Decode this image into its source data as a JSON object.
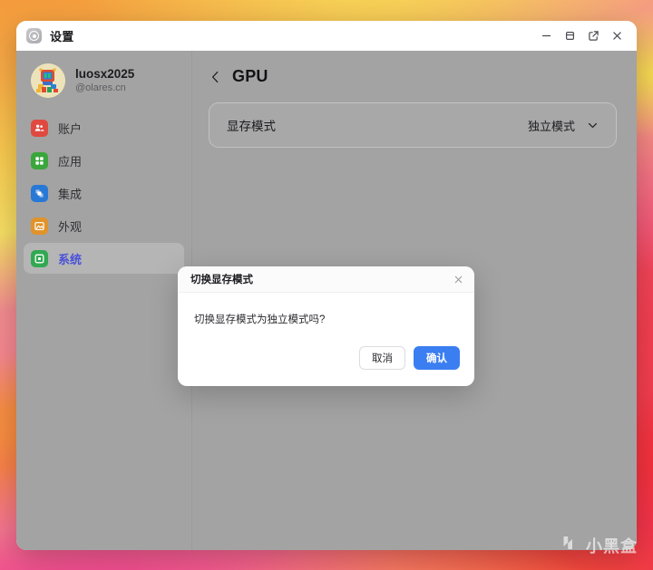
{
  "window": {
    "title": "设置",
    "app_icon": "settings-target-icon",
    "controls": [
      {
        "name": "minimize",
        "glyph": "minimize-icon"
      },
      {
        "name": "maximize",
        "glyph": "maximize-icon"
      },
      {
        "name": "open-external",
        "glyph": "external-link-icon"
      },
      {
        "name": "close",
        "glyph": "close-icon"
      }
    ]
  },
  "sidebar": {
    "profile": {
      "name": "luosx2025",
      "handle": "@olares.cn",
      "avatar": "user-avatar"
    },
    "items": [
      {
        "label": "账户",
        "icon": "account-icon",
        "color": "#e0493f",
        "active": false
      },
      {
        "label": "应用",
        "icon": "apps-icon",
        "color": "#3aa63c",
        "active": false
      },
      {
        "label": "集成",
        "icon": "integration-icon",
        "color": "#2878d6",
        "active": false
      },
      {
        "label": "外观",
        "icon": "appearance-icon",
        "color": "#e0932b",
        "active": false
      },
      {
        "label": "系统",
        "icon": "system-icon",
        "color": "#32a852",
        "active": true
      }
    ]
  },
  "content": {
    "back_label": "back-chevron",
    "title": "GPU",
    "rows": [
      {
        "label": "显存模式",
        "value": "独立模式",
        "control": "dropdown"
      }
    ]
  },
  "dialog": {
    "title": "切换显存模式",
    "message": "切换显存模式为独立模式吗?",
    "close_glyph": "close-icon",
    "cancel_label": "取消",
    "confirm_label": "确认",
    "confirm_color": "#3b7ef2"
  },
  "watermark": {
    "text": "小黑盒",
    "logo": "xiaoheihe-logo-icon"
  },
  "colors": {
    "accent_blue": "#3b7ef2",
    "active_nav_text": "#4a51d8",
    "dimmed_surface": "#a3a3a3"
  }
}
